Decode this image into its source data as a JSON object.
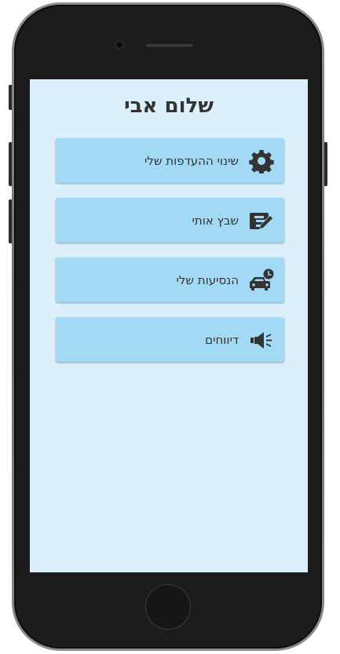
{
  "greeting": "שלום אבי",
  "menu": [
    {
      "label": "שינוי ההעדפות שלי",
      "icon": "gear-icon"
    },
    {
      "label": "שבץ אותי",
      "icon": "edit-icon"
    },
    {
      "label": "הנסיעות שלי",
      "icon": "car-clock-icon"
    },
    {
      "label": "דיווחים",
      "icon": "megaphone-icon"
    }
  ],
  "colors": {
    "screen_background": "#dcf0fb",
    "menu_button": "#a2d9f4",
    "text": "#333333"
  }
}
